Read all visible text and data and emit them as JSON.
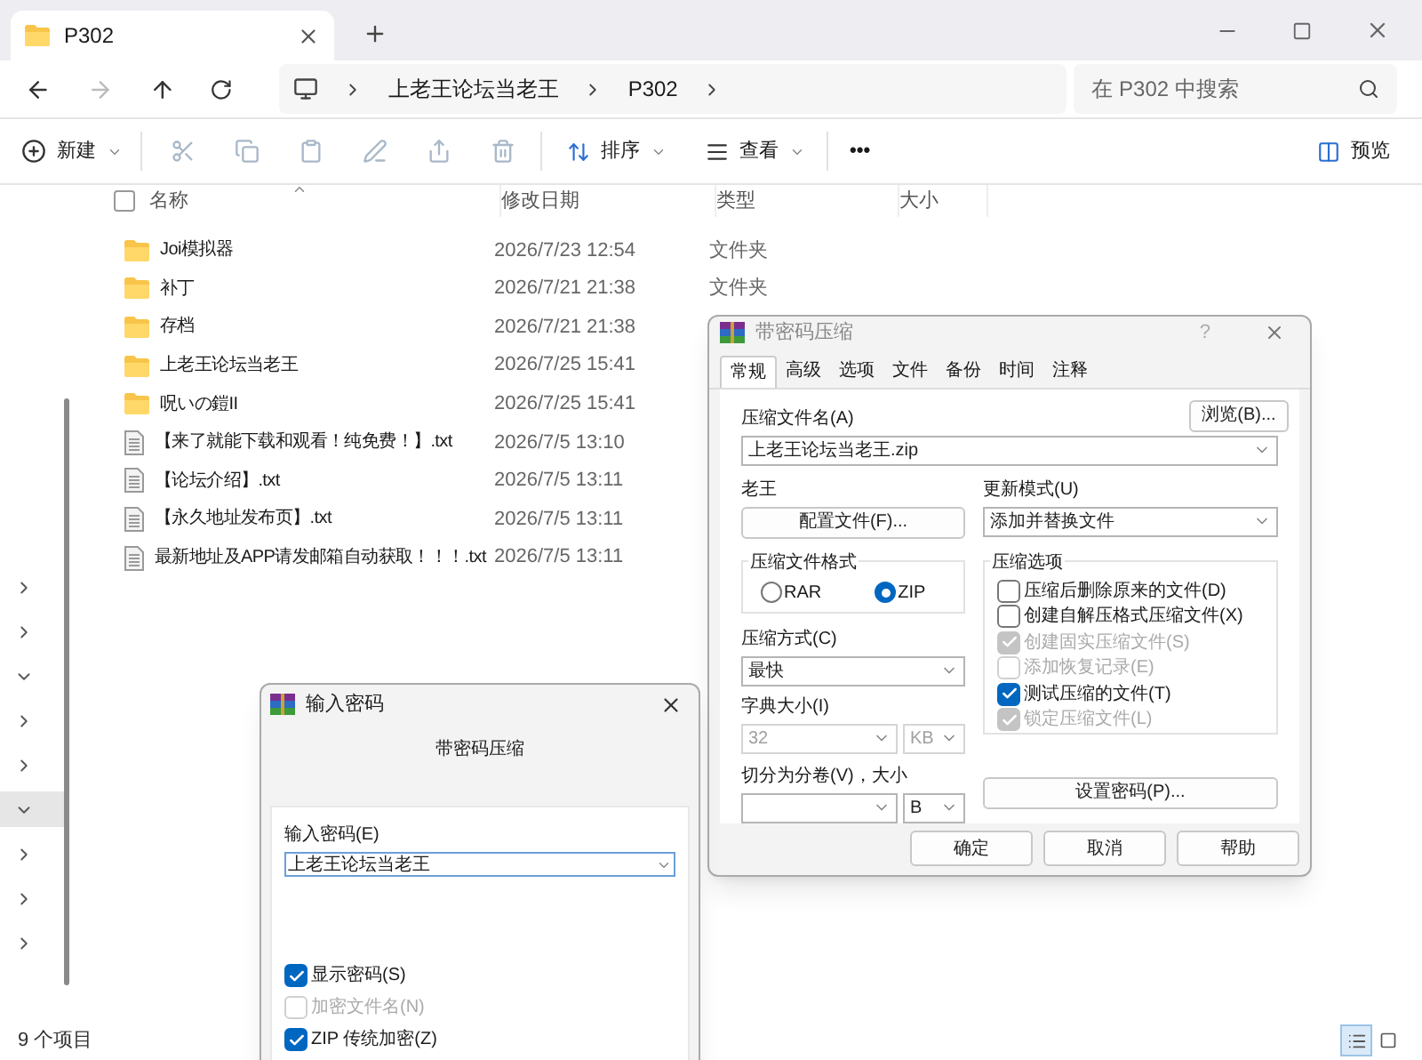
{
  "explorer": {
    "tab": {
      "title": "P302"
    },
    "breadcrumb": [
      "上老王论坛当老王",
      "P302"
    ],
    "search": {
      "placeholder": "在 P302 中搜索"
    },
    "toolbar": {
      "new": "新建",
      "sort": "排序",
      "view": "查看",
      "more": "•••",
      "preview": "预览"
    },
    "columns": [
      "名称",
      "修改日期",
      "类型",
      "大小"
    ],
    "select_all": {
      "checked": false
    },
    "rows": [
      {
        "kind": "folder",
        "name": "Joi模拟器",
        "date": "2026/7/23 12:54",
        "type": "文件夹"
      },
      {
        "kind": "folder",
        "name": "补丁",
        "date": "2026/7/21 21:38",
        "type": "文件夹"
      },
      {
        "kind": "folder",
        "name": "存档",
        "date": "2026/7/21 21:38"
      },
      {
        "kind": "folder",
        "name": "上老王论坛当老王",
        "date": "2026/7/25 15:41"
      },
      {
        "kind": "folder",
        "name": "呪いの鎧II",
        "date": "2026/7/25 15:41"
      },
      {
        "kind": "file",
        "name": "【来了就能下载和观看！纯免费！】.txt",
        "date": "2026/7/5 13:10"
      },
      {
        "kind": "file",
        "name": "【论坛介绍】.txt",
        "date": "2026/7/5 13:11"
      },
      {
        "kind": "file",
        "name": "【永久地址发布页】.txt",
        "date": "2026/7/5 13:11"
      },
      {
        "kind": "file",
        "name": "最新地址及APP请发邮箱自动获取！！！.txt",
        "date": "2026/7/5 13:11"
      }
    ],
    "sidebar": {
      "items": [
        {
          "expanded": false,
          "selected": false
        },
        {
          "expanded": false,
          "selected": false
        },
        {
          "expanded": true,
          "selected": false
        },
        {
          "expanded": false,
          "selected": false
        },
        {
          "expanded": false,
          "selected": false
        },
        {
          "expanded": true,
          "selected": true
        },
        {
          "expanded": false,
          "selected": false
        },
        {
          "expanded": false,
          "selected": false
        },
        {
          "expanded": false,
          "selected": false
        }
      ]
    },
    "status_bar": "9 个项目",
    "view_buttons": [
      {
        "kind": "details",
        "selected": true
      },
      {
        "kind": "tiles",
        "selected": false
      }
    ]
  },
  "archive_dialog": {
    "title": "带密码压缩",
    "help": "?",
    "tabs": [
      {
        "label": "常规",
        "selected": true
      },
      {
        "label": "高级",
        "selected": false
      },
      {
        "label": "选项",
        "selected": false
      },
      {
        "label": "文件",
        "selected": false
      },
      {
        "label": "备份",
        "selected": false
      },
      {
        "label": "时间",
        "selected": false
      },
      {
        "label": "注释",
        "selected": false
      }
    ],
    "archive_name": {
      "label": "压缩文件名(A)",
      "value": "上老王论坛当老王.zip"
    },
    "browse_button": "浏览(B)...",
    "profile": {
      "label": "老王",
      "button": "配置文件(F)..."
    },
    "update_mode": {
      "label": "更新模式(U)",
      "value": "添加并替换文件"
    },
    "format": {
      "label": "压缩文件格式",
      "options": [
        {
          "label": "RAR",
          "selected": false
        },
        {
          "label": "ZIP",
          "selected": true
        }
      ]
    },
    "method": {
      "label": "压缩方式(C)",
      "value": "最快"
    },
    "dictionary": {
      "label": "字典大小(I)",
      "value": "32",
      "unit": "KB",
      "disabled": true
    },
    "split": {
      "label": "切分为分卷(V)，大小",
      "unit": "B"
    },
    "options": {
      "label": "压缩选项",
      "items": [
        {
          "label": "压缩后删除原来的文件(D)",
          "checked": false,
          "disabled": false
        },
        {
          "label": "创建自解压格式压缩文件(X)",
          "checked": false,
          "disabled": false
        },
        {
          "label": "创建固实压缩文件(S)",
          "checked": true,
          "disabled": true
        },
        {
          "label": "添加恢复记录(E)",
          "checked": false,
          "disabled": true
        },
        {
          "label": "测试压缩的文件(T)",
          "checked": true,
          "disabled": false
        },
        {
          "label": "锁定压缩文件(L)",
          "checked": true,
          "disabled": true
        }
      ]
    },
    "password_button": "设置密码(P)...",
    "buttons": [
      "确定",
      "取消",
      "帮助"
    ]
  },
  "password_dialog": {
    "title": "输入密码",
    "subtitle": "带密码压缩",
    "field": {
      "label": "输入密码(E)",
      "value": "上老王论坛当老王"
    },
    "options": [
      {
        "label": "显示密码(S)",
        "checked": true,
        "disabled": false
      },
      {
        "label": "加密文件名(N)",
        "checked": false,
        "disabled": true
      },
      {
        "label": "ZIP 传统加密(Z)",
        "checked": true,
        "disabled": false
      }
    ]
  }
}
